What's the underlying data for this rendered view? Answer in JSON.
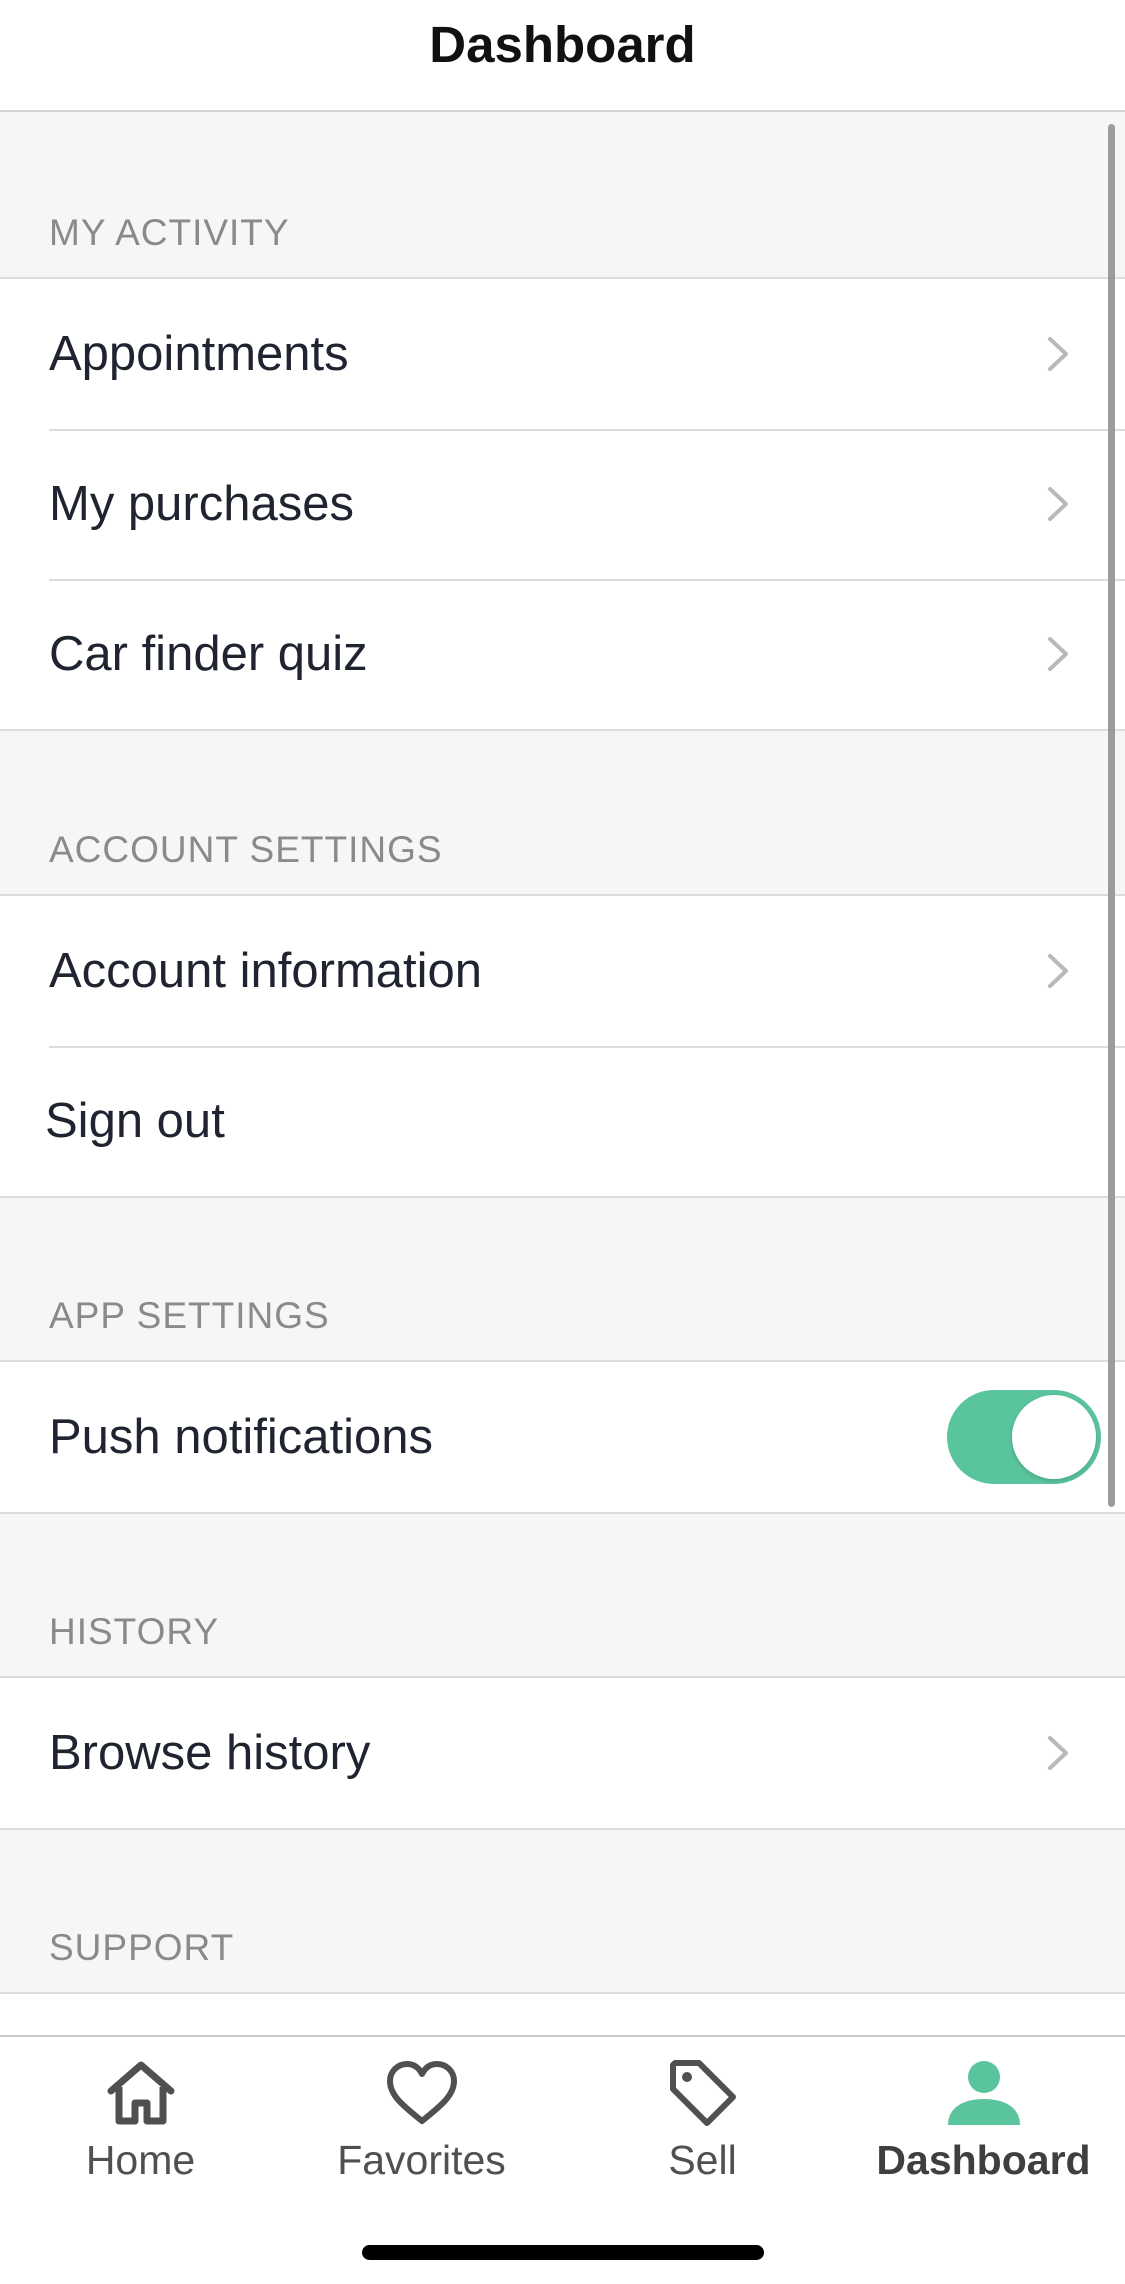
{
  "header": {
    "title": "Dashboard"
  },
  "sections": {
    "my_activity": {
      "title": "MY ACTIVITY",
      "items": [
        "Appointments",
        "My purchases",
        "Car finder quiz"
      ]
    },
    "account_settings": {
      "title": "ACCOUNT SETTINGS",
      "items": [
        "Account information",
        "Sign out"
      ]
    },
    "app_settings": {
      "title": "APP SETTINGS",
      "items": [
        {
          "label": "Push notifications",
          "toggle_on": true
        }
      ]
    },
    "history": {
      "title": "HISTORY",
      "items": [
        "Browse history"
      ]
    },
    "support": {
      "title": "SUPPORT"
    }
  },
  "tabbar": {
    "tabs": [
      {
        "label": "Home",
        "icon": "house-icon",
        "active": false
      },
      {
        "label": "Favorites",
        "icon": "heart-icon",
        "active": false
      },
      {
        "label": "Sell",
        "icon": "price-tag-icon",
        "active": false
      },
      {
        "label": "Dashboard",
        "icon": "person-icon",
        "active": true
      }
    ]
  },
  "colors": {
    "accent": "#5ac49c",
    "background": "#f6f6f6",
    "section_header_text": "#8a8a8e",
    "row_text": "#1f2430"
  }
}
